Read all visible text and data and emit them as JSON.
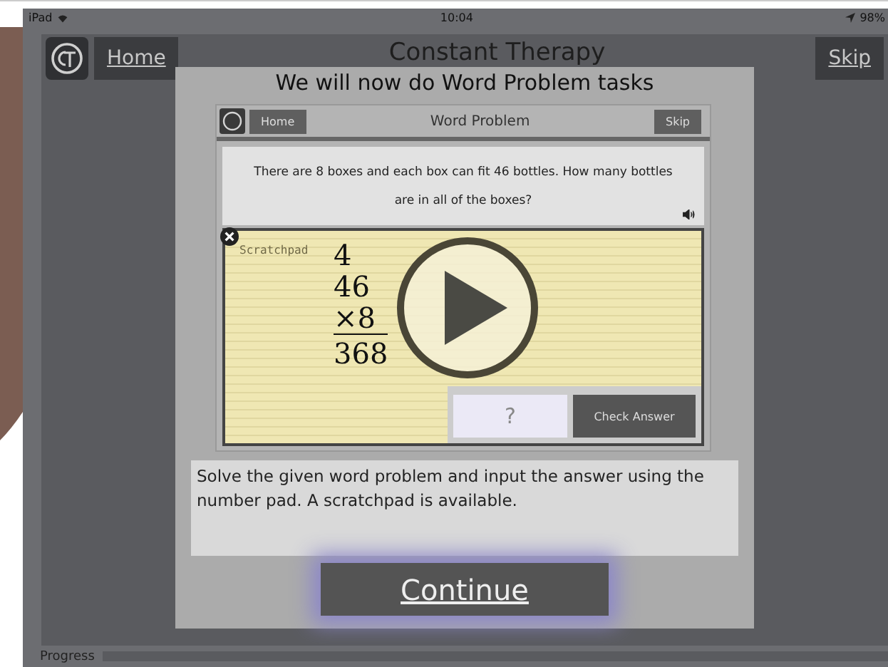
{
  "status_bar": {
    "device": "iPad",
    "time": "10:04",
    "battery": "98%"
  },
  "header": {
    "home_button": "Home",
    "title": "Constant Therapy",
    "skip_button": "Skip"
  },
  "modal": {
    "title": "We will now do Word Problem tasks",
    "preview": {
      "home_button": "Home",
      "title": "Word Problem",
      "skip_button": "Skip",
      "question": "There are 8 boxes and each box can fit 46 bottles. How many bottles are in all of the boxes?",
      "scratchpad_label": "Scratchpad",
      "scratch_work": [
        "4",
        "46",
        "×8",
        "368"
      ],
      "answer_placeholder": "?",
      "check_button": "Check Answer"
    },
    "description": "Solve the given word problem and input the answer using the number pad. A scratchpad is available.",
    "continue_button": "Continue"
  },
  "progress": {
    "label": "Progress",
    "level": 0
  }
}
